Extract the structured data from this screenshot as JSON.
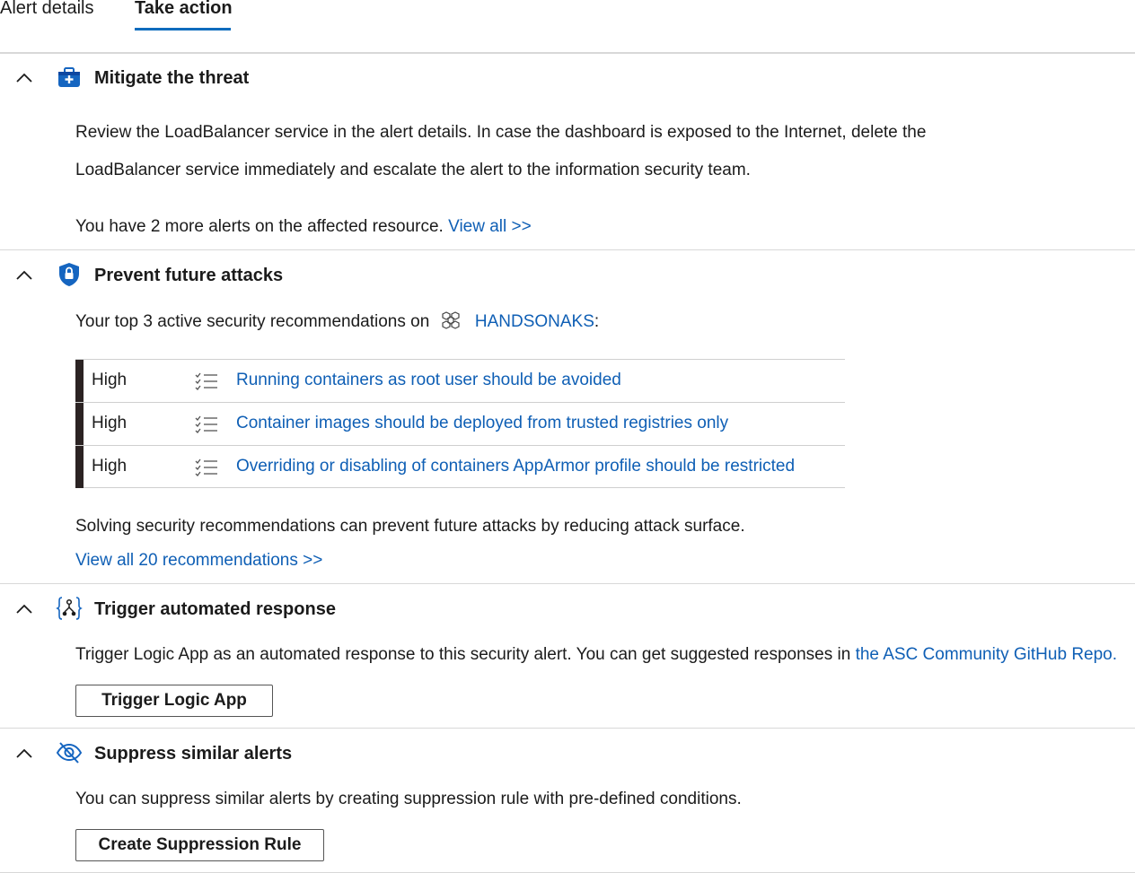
{
  "tabs": [
    {
      "label": "Alert details",
      "active": false
    },
    {
      "label": "Take action",
      "active": true
    }
  ],
  "colors": {
    "accent": "#0f6cbd",
    "link": "#0f5fb5",
    "severity_bar": "#2b2323"
  },
  "mitigate": {
    "title": "Mitigate the threat",
    "icon": "toolbox-icon",
    "body_line1": "Review the LoadBalancer service in the alert details. In case the dashboard is exposed to the Internet, delete the",
    "body_line2": "LoadBalancer service immediately and escalate the alert to the information security team.",
    "more_alerts_text": "You have 2 more alerts on the affected resource.",
    "view_all_link": "View all >>"
  },
  "prevent": {
    "title": "Prevent future attacks",
    "icon": "shield-lock-icon",
    "intro_text": "Your top 3 active security recommendations on",
    "resource_icon": "kubernetes-cluster-icon",
    "resource_name": "HANDSONAKS",
    "intro_suffix": ":",
    "recommendations": [
      {
        "severity": "High",
        "title": "Running containers as root user should be avoided"
      },
      {
        "severity": "High",
        "title": "Container images should be deployed from trusted registries only"
      },
      {
        "severity": "High",
        "title": "Overriding or disabling of containers AppArmor profile should be restricted"
      }
    ],
    "summary": "Solving security recommendations can prevent future attacks by reducing attack surface.",
    "view_all_link": "View all 20 recommendations >>"
  },
  "trigger": {
    "title": "Trigger automated response",
    "icon": "logic-app-icon",
    "body_text": "Trigger Logic App as an automated response to this security alert. You can get suggested responses in",
    "repo_link": "the ASC Community GitHub Repo.",
    "button_label": "Trigger Logic App"
  },
  "suppress": {
    "title": "Suppress similar alerts",
    "icon": "eye-hidden-icon",
    "body_text": "You can suppress similar alerts by creating suppression rule with pre-defined conditions.",
    "button_label": "Create Suppression Rule"
  }
}
